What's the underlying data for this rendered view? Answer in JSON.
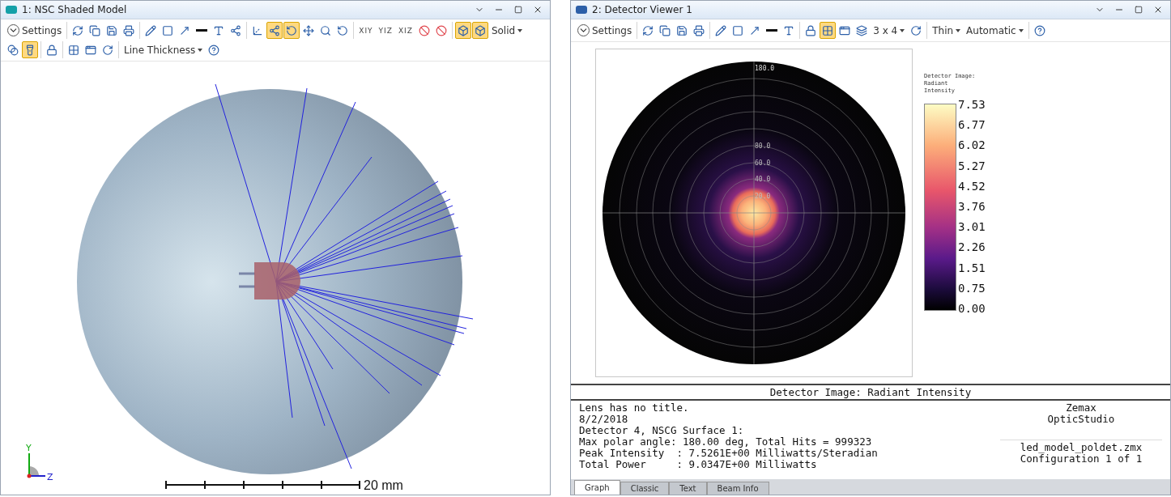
{
  "windows": [
    {
      "title": "1: NSC Shaded Model",
      "toolbar_rows": [
        [
          [
            {
              "kind": "settings",
              "text": "Settings"
            }
          ],
          [
            {
              "kind": "icon",
              "selected": false
            },
            {
              "kind": "icon",
              "selected": false
            },
            {
              "kind": "icon",
              "selected": false
            },
            {
              "kind": "icon",
              "selected": false
            }
          ],
          [
            {
              "kind": "icon",
              "selected": false
            },
            {
              "kind": "icon",
              "selected": false
            },
            {
              "kind": "icon",
              "selected": false
            },
            {
              "kind": "icon",
              "selected": false
            },
            {
              "kind": "icon",
              "selected": false
            },
            {
              "kind": "icon",
              "selected": false
            }
          ],
          [
            {
              "kind": "icon",
              "selected": false
            },
            {
              "kind": "icon",
              "selected": true
            },
            {
              "kind": "icon",
              "selected": true
            },
            {
              "kind": "icon",
              "selected": false
            },
            {
              "kind": "icon",
              "selected": false
            },
            {
              "kind": "icon",
              "selected": false
            }
          ],
          [
            {
              "kind": "label",
              "text": "XIY"
            },
            {
              "kind": "label",
              "text": "YIZ"
            },
            {
              "kind": "label",
              "text": "XIZ"
            },
            {
              "kind": "icon",
              "selected": false
            },
            {
              "kind": "icon",
              "selected": false
            }
          ],
          [
            {
              "kind": "icon",
              "selected": true
            },
            {
              "kind": "icon",
              "selected": true
            },
            {
              "kind": "dropdown",
              "text": "Solid"
            }
          ]
        ],
        [
          [
            {
              "kind": "icon",
              "selected": false
            },
            {
              "kind": "icon",
              "selected": true
            }
          ],
          [
            {
              "kind": "icon",
              "selected": false
            }
          ],
          [
            {
              "kind": "icon",
              "selected": false
            },
            {
              "kind": "icon",
              "selected": false
            },
            {
              "kind": "icon",
              "selected": false
            }
          ],
          [
            {
              "kind": "dropdown",
              "text": "Line Thickness"
            },
            {
              "kind": "icon",
              "selected": false
            }
          ]
        ]
      ],
      "axes": {
        "vertical": "Y",
        "horizontal": "Z"
      },
      "scale": "20 mm"
    },
    {
      "title": "2: Detector Viewer 1",
      "toolbar_rows": [
        [
          [
            {
              "kind": "settings",
              "text": "Settings"
            }
          ],
          [
            {
              "kind": "icon",
              "selected": false
            },
            {
              "kind": "icon",
              "selected": false
            },
            {
              "kind": "icon",
              "selected": false
            },
            {
              "kind": "icon",
              "selected": false
            }
          ],
          [
            {
              "kind": "icon",
              "selected": false
            },
            {
              "kind": "icon",
              "selected": false
            },
            {
              "kind": "icon",
              "selected": false
            },
            {
              "kind": "icon",
              "selected": false
            },
            {
              "kind": "icon",
              "selected": false
            }
          ],
          [
            {
              "kind": "icon",
              "selected": false
            },
            {
              "kind": "icon",
              "selected": true
            },
            {
              "kind": "icon",
              "selected": false
            },
            {
              "kind": "icon",
              "selected": false
            },
            {
              "kind": "dropdown",
              "text": "3 x 4"
            },
            {
              "kind": "icon",
              "selected": false
            }
          ],
          [
            {
              "kind": "dropdown",
              "text": "Thin"
            },
            {
              "kind": "dropdown",
              "text": "Automatic"
            }
          ],
          [
            {
              "kind": "icon",
              "selected": false
            }
          ]
        ]
      ],
      "polar_labels": [
        "180.0",
        "80.0",
        "60.0",
        "40.0",
        "20.0"
      ],
      "colorbar": {
        "title": "Detector Image:\nRadiant\nIntensity",
        "ticks": [
          "7.53",
          "6.77",
          "6.02",
          "5.27",
          "4.52",
          "3.76",
          "3.01",
          "2.26",
          "1.51",
          "0.75",
          "0.00"
        ]
      },
      "report": {
        "heading": "Detector Image: Radiant Intensity",
        "lines": [
          "Lens has no title.",
          "8/2/2018",
          "Detector 4, NSCG Surface 1:",
          "Max polar angle: 180.00 deg, Total Hits = 999323",
          "Peak Intensity  : 7.5261E+00 Milliwatts/Steradian",
          "Total Power     : 9.0347E+00 Milliwatts"
        ],
        "brand": [
          "Zemax",
          "OpticStudio"
        ],
        "file": [
          "led_model_poldet.zmx",
          "Configuration 1 of 1"
        ]
      },
      "tabs": [
        {
          "label": "Graph",
          "selected": true
        },
        {
          "label": "Classic",
          "selected": false
        },
        {
          "label": "Text",
          "selected": false
        },
        {
          "label": "Beam Info",
          "selected": false
        }
      ]
    }
  ]
}
